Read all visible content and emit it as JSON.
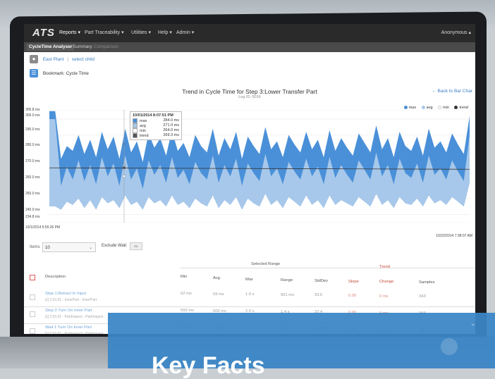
{
  "nav": {
    "logo": "ATS",
    "items": [
      "Reports ▾",
      "Part Traceability ▾",
      "Utilities ▾",
      "Help ▾",
      "Admin ▾"
    ],
    "user": "Anonymous ▴"
  },
  "subtabs": [
    "CycleTime Analyser",
    "Summary",
    "Comparison"
  ],
  "breadcrumb": {
    "plant": "East Plant",
    "separator": "|",
    "child": "select child"
  },
  "bookmark": {
    "label": "Bookmark: Cycle Time"
  },
  "chart": {
    "title": "Trend in Cycle Time for Step 3:Lower Transfer Part",
    "subtitle": "Log ID: 5016",
    "back_link": "← Back to Bar Char",
    "legend": [
      {
        "name": "max",
        "color": "#4a90d9"
      },
      {
        "name": "avg",
        "color": "#a7c8ea"
      },
      {
        "name": "min",
        "color": "#ffffff"
      },
      {
        "name": "trend",
        "color": "#333333"
      }
    ],
    "start_date": "10/1/2014 5:55:26 PM",
    "end_date": "10/22/2014 7:38:07 AM",
    "tooltip": {
      "time": "10/01/2014 8:07:51 PM",
      "rows": [
        {
          "name": "max",
          "value": "284.0 ms",
          "color": "#4a90d9"
        },
        {
          "name": "avg",
          "value": "271.0 ms",
          "color": "#a7c8ea"
        },
        {
          "name": "min",
          "value": "264.0 ms",
          "color": "#ffffff"
        },
        {
          "name": "trend",
          "value": "269.3 ms",
          "color": "#555555"
        }
      ]
    }
  },
  "chart_data": {
    "type": "area",
    "title": "Trend in Cycle Time for Step 3:Lower Transfer Part",
    "xlabel": "",
    "ylabel": "",
    "y_ticks": [
      "305.8 ms",
      "300.0 ms",
      "290.0 ms",
      "280.0 ms",
      "270.0 ms",
      "260.0 ms",
      "250.0 ms",
      "240.0 ms",
      "234.8 ms"
    ],
    "ylim": [
      234.8,
      305.8
    ],
    "x_range": [
      "10/1/2014 5:55:26 PM",
      "10/22/2014 7:38:07 AM"
    ],
    "series": [
      {
        "name": "max",
        "values": [
          305,
          305,
          275,
          283,
          280,
          290,
          278,
          287,
          276,
          292,
          281,
          289,
          275,
          294,
          279,
          286,
          273,
          291,
          282,
          288,
          277,
          293,
          280,
          285,
          276,
          290,
          283,
          279,
          294,
          277,
          288,
          281,
          292,
          275,
          289,
          283,
          278,
          295,
          281,
          286,
          276,
          290,
          284,
          279,
          292,
          281,
          287,
          276,
          293,
          280,
          288,
          282,
          277,
          291,
          285,
          279,
          296,
          281,
          288,
          276,
          292,
          283,
          280,
          289,
          277,
          294,
          282,
          286,
          279,
          291,
          284,
          278,
          302
        ]
      },
      {
        "name": "avg",
        "values": [
          300,
          300,
          258,
          270,
          262,
          274,
          261,
          271,
          259,
          276,
          264,
          272,
          258,
          277,
          262,
          269,
          256,
          274,
          265,
          271,
          260,
          276,
          263,
          268,
          259,
          273,
          266,
          262,
          277,
          260,
          271,
          264,
          275,
          258,
          272,
          266,
          261,
          278,
          264,
          269,
          259,
          273,
          267,
          262,
          275,
          264,
          270,
          259,
          276,
          263,
          271,
          265,
          260,
          274,
          268,
          262,
          279,
          264,
          271,
          259,
          275,
          266,
          263,
          272,
          260,
          277,
          265,
          269,
          262,
          274,
          267,
          261,
          290
        ]
      },
      {
        "name": "min",
        "values": [
          245,
          245,
          243,
          248,
          246,
          250,
          244,
          249,
          243,
          251,
          247,
          249,
          244,
          252,
          246,
          248,
          243,
          251,
          247,
          249,
          245,
          252,
          246,
          248,
          244,
          250,
          247,
          245,
          252,
          244,
          249,
          246,
          251,
          243,
          250,
          247,
          245,
          253,
          246,
          249,
          244,
          251,
          248,
          245,
          252,
          246,
          249,
          244,
          252,
          246,
          249,
          247,
          245,
          251,
          248,
          245,
          253,
          246,
          249,
          244,
          251,
          247,
          246,
          250,
          245,
          252,
          247,
          249,
          246,
          251,
          248,
          245,
          260
        ]
      },
      {
        "name": "trend",
        "values": [
          269.3,
          268.4
        ]
      }
    ],
    "grid": true,
    "legend_position": "top-right"
  },
  "controls": {
    "items_label": "Items",
    "items_value": "10",
    "exclude_label": "Exclude Wait:",
    "exclude_value": "no"
  },
  "table": {
    "group_selected": "Selected Range",
    "group_trend": "Trend",
    "headers": [
      "Description",
      "Min",
      "Avg",
      "Max",
      "Range",
      "StdDev",
      "Slope",
      "Change",
      "Samples"
    ],
    "rows": [
      {
        "desc": "Step 1:Retract In Input",
        "sub": "[1] C10.01 - InnerPart - InnerPart",
        "min": "62 ms",
        "avg": "59 ms",
        "max": "1.0 s",
        "range": "961 ms",
        "std": "33.6",
        "slope": "0.00",
        "change": "0 ms",
        "samples": "343"
      },
      {
        "desc": "Step 2:Turn On Inner Part",
        "sub": "[1] C10.01 - PartInspect - PartInspect",
        "min": "592 ms",
        "avg": "606 ms",
        "max": "2.0 s",
        "range": "1.4 s",
        "std": "37.4",
        "slope": "0.00",
        "change": "0 ms",
        "samples": "343"
      },
      {
        "desc": "Wait 1:Turn On Inner Part",
        "sub": "[1] C10.01 - PartInspect - PartInspect",
        "min": "614 ms",
        "avg": "663 ms",
        "max": "55 s",
        "range": "97 s",
        "std": "1,456.2",
        "slope": "0.00",
        "change": "0 ms",
        "samples": "343"
      }
    ]
  },
  "overlay": {
    "title": "Key Facts"
  }
}
